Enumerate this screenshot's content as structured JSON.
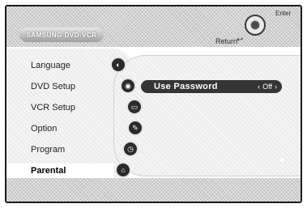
{
  "header": {
    "brand": "SAMSUNG DVD-VCR",
    "return_label": "Return",
    "enter_label": "Enter"
  },
  "menu": {
    "items": [
      {
        "label": "Language",
        "icon": "language-icon"
      },
      {
        "label": "DVD Setup",
        "icon": "disc-icon"
      },
      {
        "label": "VCR Setup",
        "icon": "tape-icon"
      },
      {
        "label": "Option",
        "icon": "option-icon"
      },
      {
        "label": "Program",
        "icon": "clock-icon"
      },
      {
        "label": "Parental",
        "icon": "lock-icon"
      }
    ],
    "selected": "Parental"
  },
  "content": {
    "option_label": "Use Password",
    "option_value": "Off"
  },
  "colors": {
    "highlight": "#353535"
  }
}
